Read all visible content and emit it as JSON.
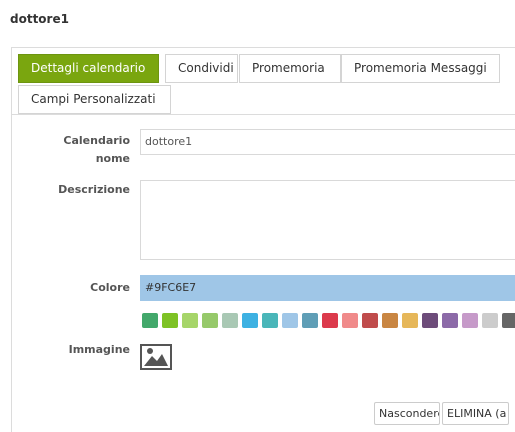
{
  "page": {
    "title": "dottore1"
  },
  "tabs": [
    {
      "label": "Dettagli calendario",
      "active": true
    },
    {
      "label": "Condividi",
      "active": false
    },
    {
      "label": "Promemoria",
      "active": false
    },
    {
      "label": "Promemoria Messaggi",
      "active": false
    },
    {
      "label": "Campi Personalizzati",
      "active": false
    }
  ],
  "form": {
    "name_label_line1": "Calendario",
    "name_label_line2": "nome",
    "name_value": "dottore1",
    "description_label": "Descrizione",
    "description_value": "",
    "color_label": "Colore",
    "color_value": "#9FC6E7",
    "image_label": "Immagine",
    "image_icon": "image-icon"
  },
  "palette": [
    "#42a86b",
    "#7ec225",
    "#a6d569",
    "#96c96a",
    "#a9c8b4",
    "#3db1e2",
    "#4ab6b9",
    "#9fc6e7",
    "#5f9eb6",
    "#dc3a4c",
    "#f08a8a",
    "#c04c4c",
    "#c98642",
    "#e6b759",
    "#6d4c7a",
    "#8c6aa8",
    "#c69ac9",
    "#cccccc",
    "#666666"
  ],
  "buttons": {
    "hide_label": "Nascondere",
    "delete_label": "ELIMINA (a"
  }
}
